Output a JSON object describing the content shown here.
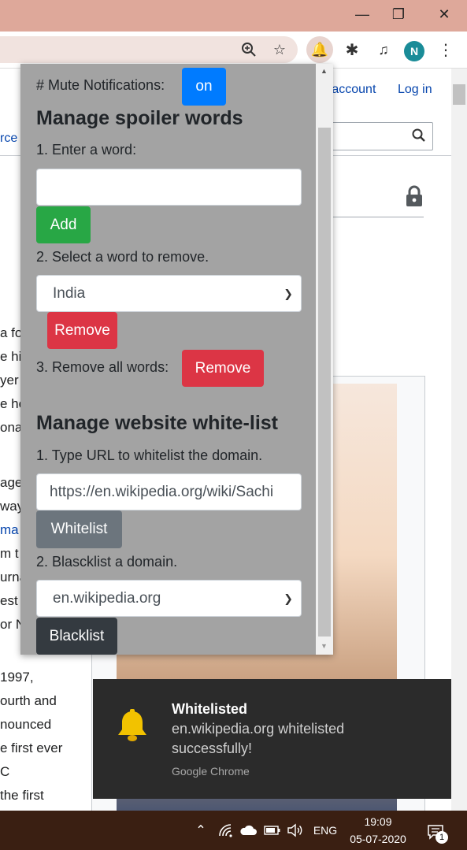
{
  "browser": {
    "avatar_letter": "N"
  },
  "wiki": {
    "create_account": "e account",
    "log_in": "Log in",
    "left_fragment": "rce",
    "body_lines": [
      "a fo",
      "e hi",
      "yer",
      "e he",
      "ona",
      "age",
      "way",
      "ma",
      "m t",
      "urna",
      "est",
      "or N",
      " 1997,",
      "ourth and",
      "nounced",
      "e first ever",
      "C",
      " the first"
    ]
  },
  "popup": {
    "mute_label": "# Mute Notifications:",
    "mute_toggle": "on",
    "spoiler_heading": "Manage spoiler words",
    "enter_word_label": "1. Enter a word:",
    "enter_word_value": "",
    "add_button": "Add",
    "select_remove_label": "2. Select a word to remove.",
    "select_remove_value": "India",
    "remove_button": "Remove",
    "remove_all_label": "3. Remove all words:",
    "remove_all_button": "Remove",
    "whitelist_heading": "Manage website white-list",
    "whitelist_url_label": "1. Type URL to whitelist the domain.",
    "whitelist_url_value": "https://en.wikipedia.org/wiki/Sachi",
    "whitelist_button": "Whitelist",
    "blacklist_label": "2. Blasck​list a domain.",
    "blacklist_value": "en.wikipedia.org",
    "blacklist_button": "Blacklist"
  },
  "notification": {
    "title": "Whitelisted",
    "message_line1": "en.wikipedia.org whitelisted",
    "message_line2": "successfully!",
    "source": "Google Chrome"
  },
  "taskbar": {
    "language": "ENG",
    "time": "19:09",
    "date": "05-07-2020",
    "notification_count": "1"
  },
  "colors": {
    "primary": "#007bff",
    "success": "#28a745",
    "danger": "#dc3545",
    "secondary": "#6c757d",
    "dark": "#343a40",
    "popup_bg": "#a3a3a3"
  }
}
